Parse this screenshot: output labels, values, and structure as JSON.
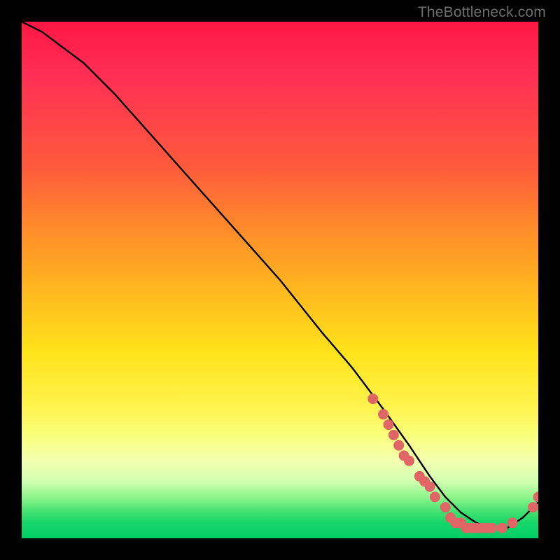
{
  "watermark": "TheBottleneck.com",
  "chart_data": {
    "type": "line",
    "title": "",
    "xlabel": "",
    "ylabel": "",
    "xlim": [
      0,
      100
    ],
    "ylim": [
      0,
      100
    ],
    "grid": false,
    "legend": false,
    "series": [
      {
        "name": "bottleneck-curve",
        "x": [
          0,
          4,
          8,
          12,
          18,
          26,
          34,
          42,
          50,
          58,
          64,
          70,
          75,
          79,
          82,
          85,
          88,
          91,
          94,
          97,
          100
        ],
        "y": [
          100,
          98,
          95,
          92,
          86,
          77,
          68,
          59,
          50,
          40,
          33,
          25,
          18,
          12,
          8,
          5,
          3,
          2,
          2,
          4,
          7
        ],
        "color": "#000000"
      }
    ],
    "markers": [
      {
        "name": "highlighted-points",
        "color": "#e06666",
        "points": [
          {
            "x": 68,
            "y": 27
          },
          {
            "x": 70,
            "y": 24
          },
          {
            "x": 71,
            "y": 22
          },
          {
            "x": 72,
            "y": 20
          },
          {
            "x": 73,
            "y": 18
          },
          {
            "x": 74,
            "y": 16
          },
          {
            "x": 75,
            "y": 15
          },
          {
            "x": 77,
            "y": 12
          },
          {
            "x": 78,
            "y": 11
          },
          {
            "x": 79,
            "y": 10
          },
          {
            "x": 80,
            "y": 8
          },
          {
            "x": 82,
            "y": 6
          },
          {
            "x": 83,
            "y": 4
          },
          {
            "x": 84,
            "y": 3
          },
          {
            "x": 85,
            "y": 3
          },
          {
            "x": 86,
            "y": 2
          },
          {
            "x": 87,
            "y": 2
          },
          {
            "x": 88,
            "y": 2
          },
          {
            "x": 89,
            "y": 2
          },
          {
            "x": 90,
            "y": 2
          },
          {
            "x": 91,
            "y": 2
          },
          {
            "x": 93,
            "y": 2
          },
          {
            "x": 95,
            "y": 3
          },
          {
            "x": 99,
            "y": 6
          },
          {
            "x": 100,
            "y": 8
          }
        ]
      }
    ]
  },
  "colors": {
    "background": "#000000",
    "curve": "#000000",
    "marker": "#e06666",
    "watermark": "#6d6d6d"
  }
}
